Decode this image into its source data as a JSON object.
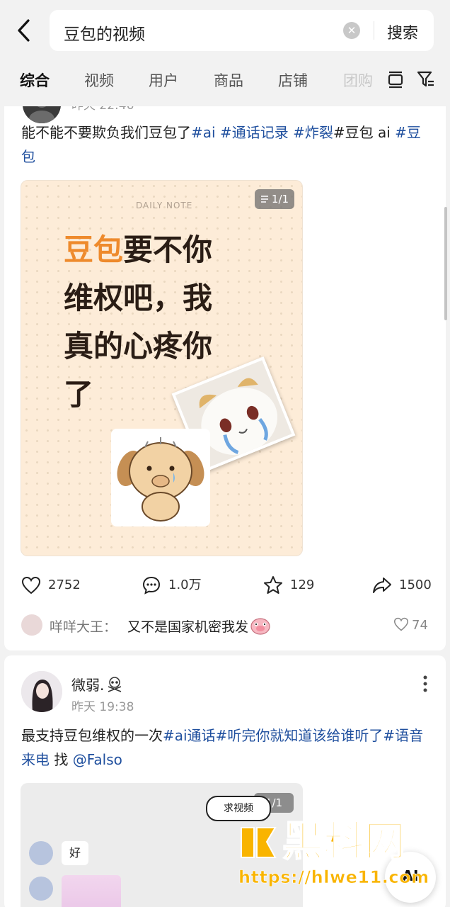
{
  "search": {
    "query": "豆包的视频",
    "submit_label": "搜索"
  },
  "tabs": [
    {
      "label": "综合"
    },
    {
      "label": "视频"
    },
    {
      "label": "用户"
    },
    {
      "label": "商品"
    },
    {
      "label": "店铺"
    },
    {
      "label": "团购"
    }
  ],
  "post1": {
    "time": "昨天 22:46",
    "text_plain_1": "能不能不要欺负我们豆包了",
    "tag_ai": "#ai",
    "tag_call": "#通话记录",
    "tag_boom": "#炸裂",
    "text_plain_2": "#豆包 ai",
    "tag_doubao": "#豆包",
    "image": {
      "header": "DAILY NOTE",
      "page_indicator": "1/1",
      "headline_highlight": "豆包",
      "headline_rest_1": "要不你",
      "headline_line_2": "维权吧，我",
      "headline_line_3": "真的心疼你",
      "headline_line_4": "了"
    },
    "likes": "2752",
    "comments": "1.0万",
    "favorites": "129",
    "shares": "1500",
    "top_comment": {
      "user": "咩咩大王：",
      "text": "又不是国家机密我发",
      "likes": "74"
    }
  },
  "post2": {
    "author": "微弱.",
    "time": "昨天 19:38",
    "text_1": "最支持豆包维权的一次",
    "tag_ai_call": "#ai通话",
    "tag_listen": "#听完你就知道该给谁听了",
    "tag_voice": "#语音来电",
    "text_2": "找",
    "mention": "@Falso",
    "image": {
      "page_indicator": "1/1",
      "sticker": "求视频",
      "chat_bubble": "好"
    }
  },
  "watermark": {
    "brand": "黑料网",
    "url": "https://hlwe11.com"
  },
  "fab_label": "AI",
  "colors": {
    "accent_link": "#1f4f9e",
    "highlight_orange": "#ee8a2c",
    "watermark_gold": "#f9b400"
  }
}
